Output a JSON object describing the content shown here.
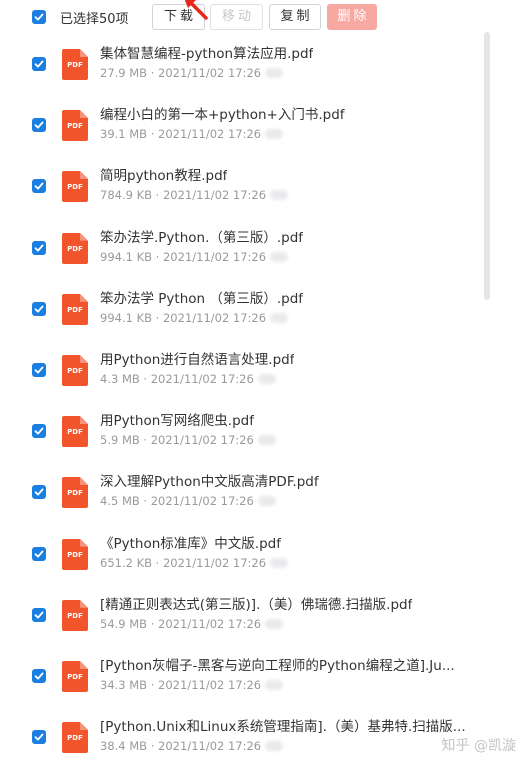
{
  "toolbar": {
    "selected_label": "已选择50项",
    "download_label": "下载",
    "move_label": "移动",
    "copy_label": "复制",
    "delete_label": "删除"
  },
  "files": [
    {
      "name": "集体智慧编程-python算法应用.pdf",
      "size": "27.9 MB",
      "date": "2021/11/02 17:26",
      "type": "PDF"
    },
    {
      "name": "编程小白的第一本+python+入门书.pdf",
      "size": "39.1 MB",
      "date": "2021/11/02 17:26",
      "type": "PDF"
    },
    {
      "name": "简明python教程.pdf",
      "size": "784.9 KB",
      "date": "2021/11/02 17:26",
      "type": "PDF"
    },
    {
      "name": "笨办法学.Python.（第三版）.pdf",
      "size": "994.1 KB",
      "date": "2021/11/02 17:26",
      "type": "PDF"
    },
    {
      "name": "笨办法学 Python （第三版）.pdf",
      "size": "994.1 KB",
      "date": "2021/11/02 17:26",
      "type": "PDF"
    },
    {
      "name": "用Python进行自然语言处理.pdf",
      "size": "4.3 MB",
      "date": "2021/11/02 17:26",
      "type": "PDF"
    },
    {
      "name": "用Python写网络爬虫.pdf",
      "size": "5.9 MB",
      "date": "2021/11/02 17:26",
      "type": "PDF"
    },
    {
      "name": "深入理解Python中文版高清PDF.pdf",
      "size": "4.5 MB",
      "date": "2021/11/02 17:26",
      "type": "PDF"
    },
    {
      "name": "《Python标准库》中文版.pdf",
      "size": "651.2 KB",
      "date": "2021/11/02 17:26",
      "type": "PDF"
    },
    {
      "name": "[精通正则表达式(第三版)].（美）佛瑞德.扫描版.pdf",
      "size": "54.9 MB",
      "date": "2021/11/02 17:26",
      "type": "PDF"
    },
    {
      "name": "[Python灰帽子-黑客与逆向工程师的Python编程之道].Ju...",
      "size": "34.3 MB",
      "date": "2021/11/02 17:26",
      "type": "PDF"
    },
    {
      "name": "[Python.Unix和Linux系统管理指南].（美）基弗特.扫描版...",
      "size": "38.4 MB",
      "date": "2021/11/02 17:26",
      "type": "PDF"
    }
  ],
  "meta_separator": "·",
  "watermark": "知乎 @凯漩",
  "colors": {
    "checkbox": "#1a7fe0",
    "pdf_icon": "#f2552c",
    "delete_button": "#f7a9a1"
  }
}
